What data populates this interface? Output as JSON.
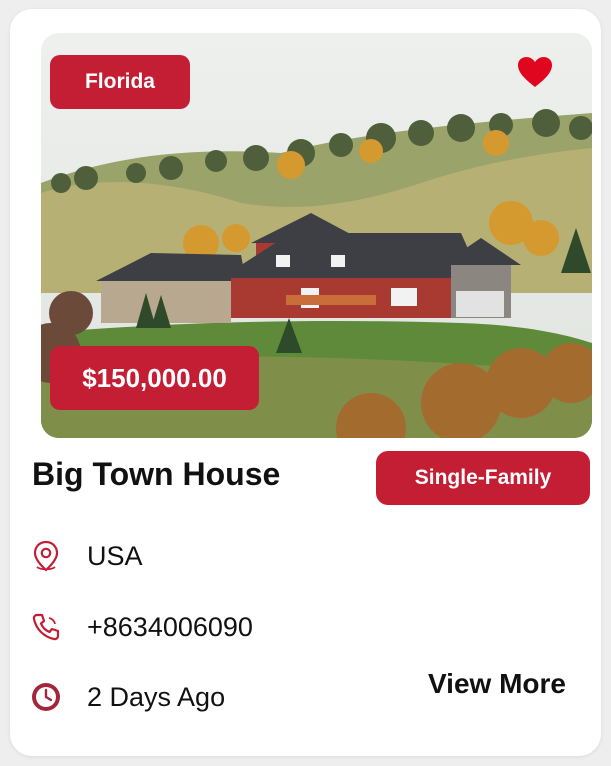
{
  "listing": {
    "state": "Florida",
    "price": "$150,000.00",
    "title": "Big Town House",
    "property_type": "Single-Family",
    "location": "USA",
    "phone": "+8634006090",
    "posted": "2 Days Ago",
    "view_more_label": "View More",
    "favorited": true
  },
  "icons": {
    "heart": "heart-icon",
    "location": "map-pin-icon",
    "phone": "phone-icon",
    "time": "clock-icon"
  },
  "colors": {
    "accent": "#c41e35",
    "text": "#111111",
    "card_background": "#ffffff"
  }
}
